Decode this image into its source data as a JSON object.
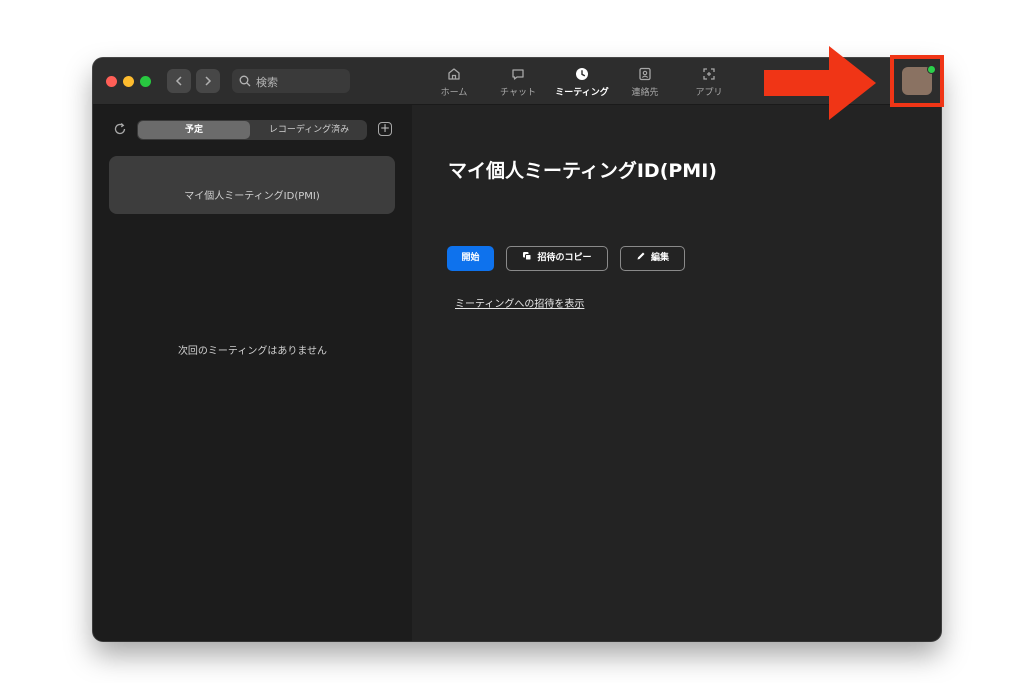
{
  "search": {
    "placeholder": "検索"
  },
  "tabs": [
    {
      "label": "ホーム",
      "icon": "home-icon",
      "active": false
    },
    {
      "label": "チャット",
      "icon": "chat-icon",
      "active": false
    },
    {
      "label": "ミーティング",
      "icon": "clock-icon",
      "active": true
    },
    {
      "label": "連絡先",
      "icon": "contacts-icon",
      "active": false
    },
    {
      "label": "アプリ",
      "icon": "apps-icon",
      "active": false
    }
  ],
  "sidebar": {
    "segment_upcoming": "予定",
    "segment_recorded": "レコーディング済み",
    "meeting_card_label": "マイ個人ミーティングID(PMI)",
    "empty_message": "次回のミーティングはありません"
  },
  "main": {
    "title": "マイ個人ミーティングID(PMI)",
    "start_label": "開始",
    "copy_invite_label": "招待のコピー",
    "edit_label": "編集",
    "show_invite_link": "ミーティングへの招待を表示"
  },
  "colors": {
    "accent": "#0e72ed",
    "highlight": "#f03516",
    "status_online": "#2ad04a"
  }
}
